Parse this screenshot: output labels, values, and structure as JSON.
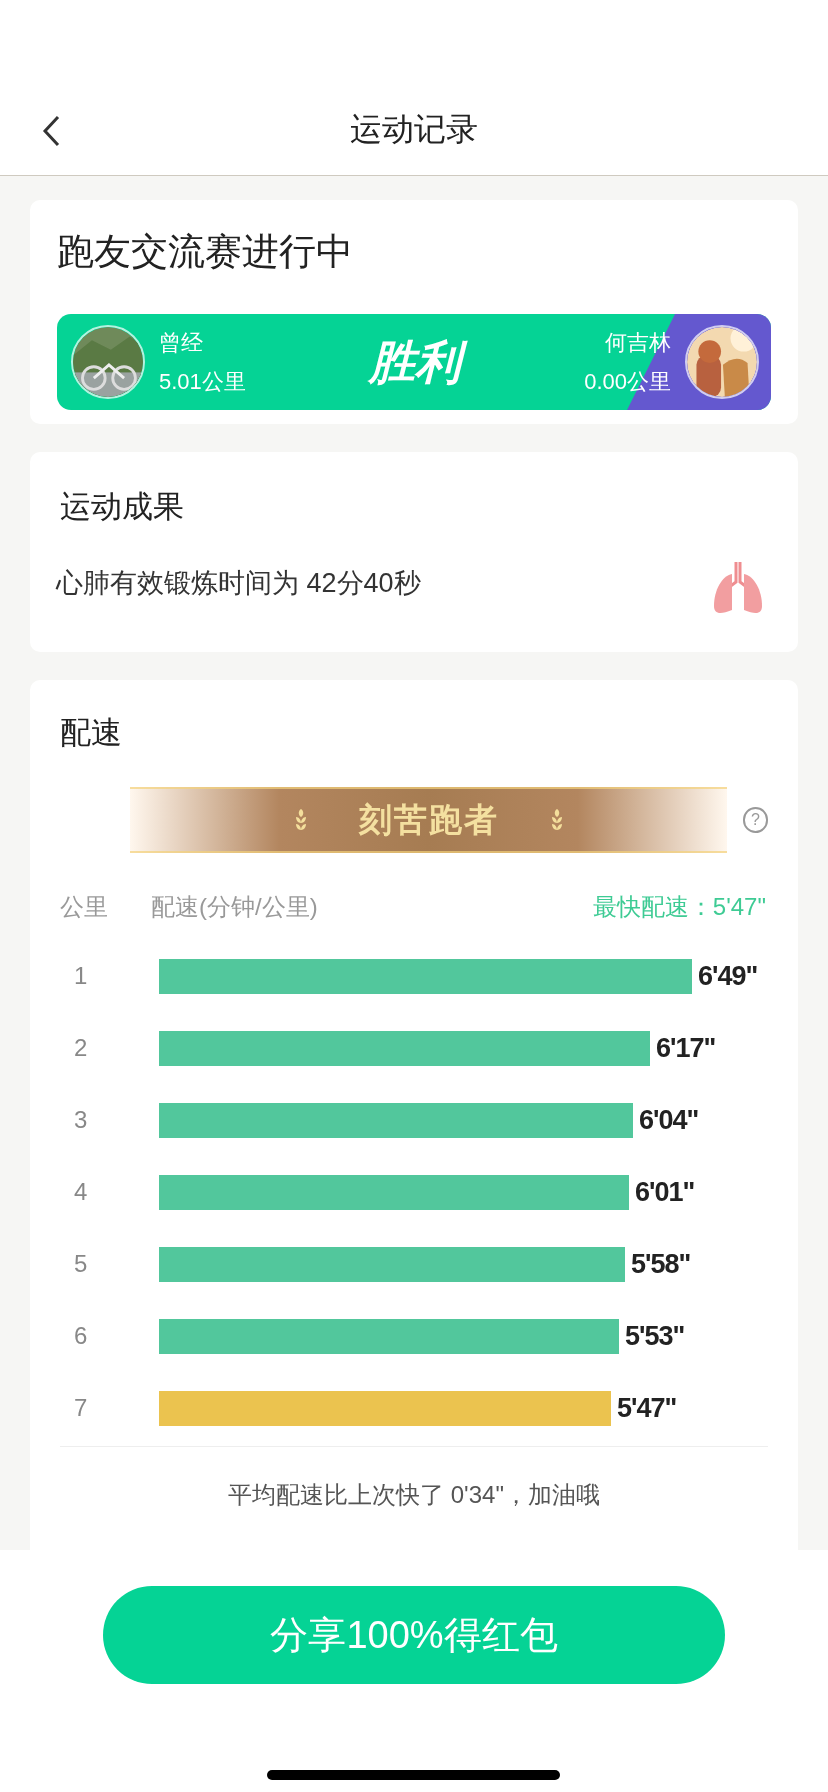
{
  "nav": {
    "title": "运动记录"
  },
  "match": {
    "title": "跑友交流赛进行中",
    "result": "胜利",
    "players": [
      {
        "name": "曾经",
        "distance": "5.01公里"
      },
      {
        "name": "何吉林",
        "distance": "0.00公里"
      }
    ]
  },
  "result_card": {
    "title": "运动成果",
    "text": "心肺有效锻炼时间为 42分40秒"
  },
  "pace": {
    "title": "配速",
    "medal": "刻苦跑者",
    "help": "?",
    "columns": [
      "公里",
      "配速(分钟/公里)"
    ],
    "fastest": "最快配速：5'47\"",
    "rows": [
      {
        "km": "1",
        "pace": "6'49\"",
        "fastest": false
      },
      {
        "km": "2",
        "pace": "6'17\"",
        "fastest": false
      },
      {
        "km": "3",
        "pace": "6'04\"",
        "fastest": false
      },
      {
        "km": "4",
        "pace": "6'01\"",
        "fastest": false
      },
      {
        "km": "5",
        "pace": "5'58\"",
        "fastest": false
      },
      {
        "km": "6",
        "pace": "5'53\"",
        "fastest": false
      },
      {
        "km": "7",
        "pace": "5'47\"",
        "fastest": true
      }
    ],
    "summary": "平均配速比上次快了 0'34\"，加油哦"
  },
  "share_button": "分享100%得红包"
}
